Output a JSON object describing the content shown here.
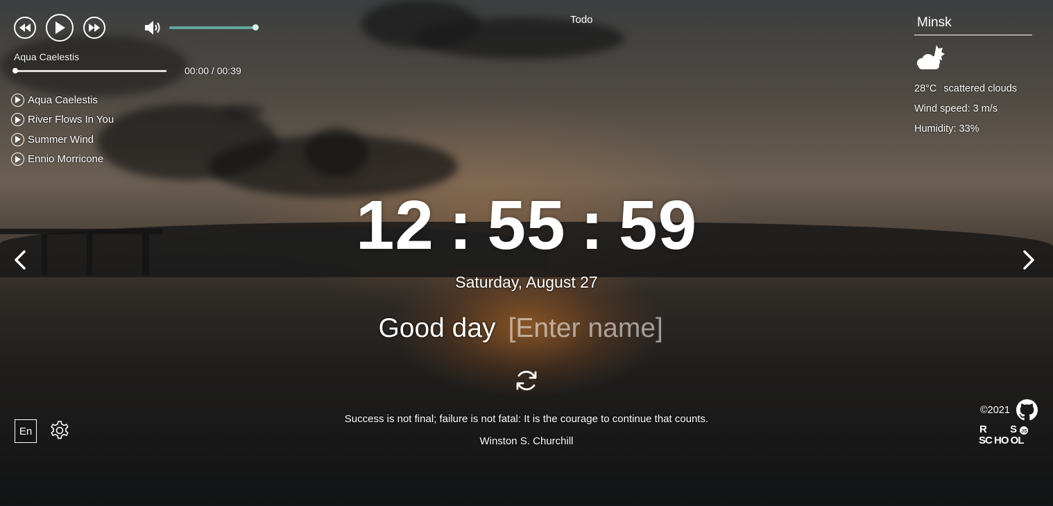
{
  "player": {
    "current_track": "Aqua Caelestis",
    "time": "00:00 / 00:39",
    "volume": 1.0,
    "progress": 0.0,
    "playlist": [
      "Aqua Caelestis",
      "River Flows In You",
      "Summer Wind",
      "Ennio Morricone"
    ]
  },
  "todo": {
    "label": "Todo"
  },
  "weather": {
    "city": "Minsk",
    "icon": "scattered-clouds-icon",
    "temperature": "28°C",
    "description": "scattered clouds",
    "wind": "Wind speed: 3 m/s",
    "humidity": "Humidity: 33%"
  },
  "clock": {
    "time": "12:55:59",
    "date": "Saturday, August 27"
  },
  "greeting": {
    "text": "Good day",
    "name_placeholder": "[Enter name]"
  },
  "quote": {
    "text": "Success is not final; failure is not fatal: It is the courage to continue that counts.",
    "author": "Winston S. Churchill"
  },
  "footer": {
    "language": "En",
    "copyright": "©2021",
    "logo_text": "RS SCHOOL"
  },
  "colors": {
    "accent": "#5fa8a0",
    "text": "#ffffff"
  }
}
